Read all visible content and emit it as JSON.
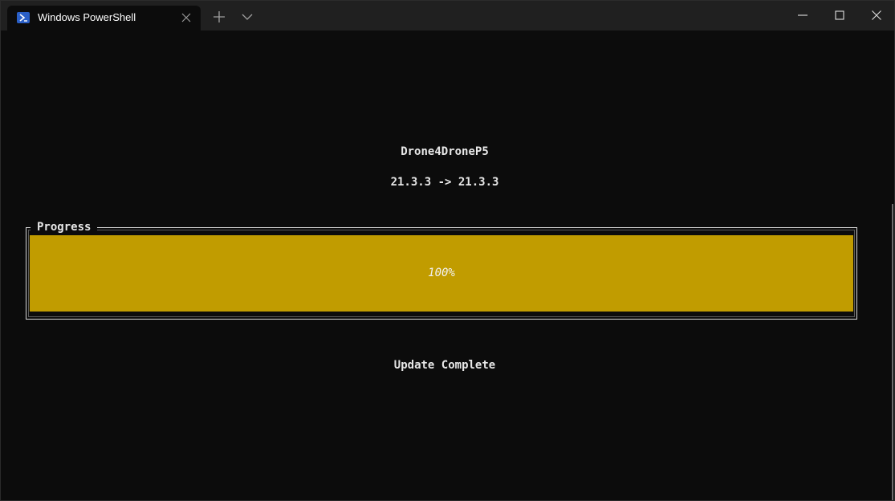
{
  "window": {
    "tab_title": "Windows PowerShell"
  },
  "icons": {
    "tab": "powershell-icon",
    "tab_close": "close-icon",
    "new_tab": "plus-icon",
    "dropdown": "chevron-down-icon",
    "minimize": "minimize-icon",
    "maximize": "maximize-icon",
    "close": "close-icon"
  },
  "terminal": {
    "app_name": "Drone4DroneP5",
    "version": "21.3.3 -> 21.3.3",
    "progress_label": "Progress",
    "progress_text": "100%",
    "progress_value": 1.0,
    "status": "Update Complete"
  },
  "colors": {
    "background": "#0c0c0c",
    "titlebar": "#202020",
    "progress_fill": "#c19c00",
    "text": "#e8e8e8"
  }
}
